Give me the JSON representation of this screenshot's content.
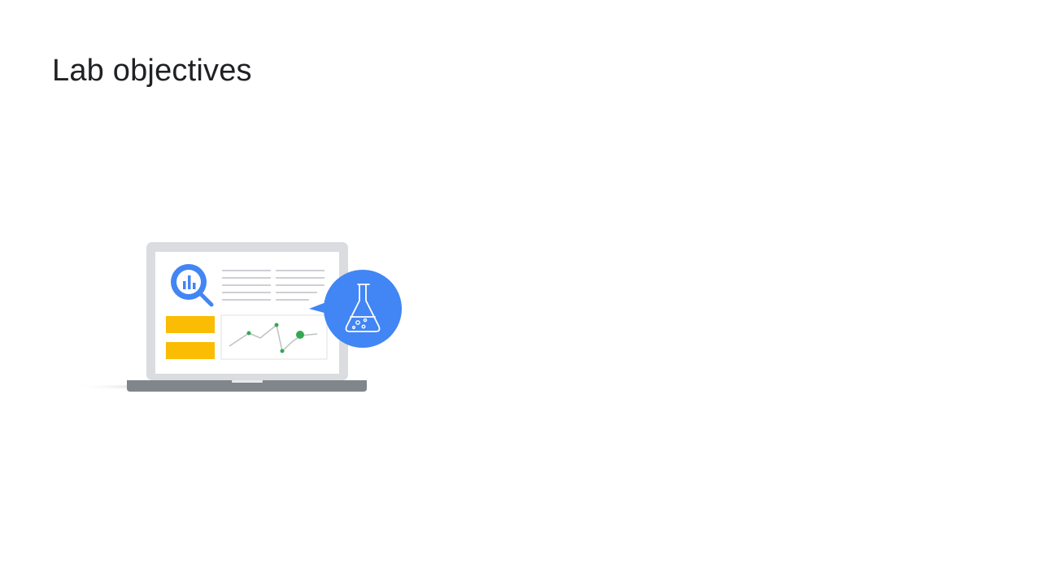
{
  "slide": {
    "title": "Lab objectives"
  },
  "illustration": {
    "icons": [
      "laptop-icon",
      "bigquery-magnifier-icon",
      "lab-flask-icon",
      "line-chart-icon"
    ],
    "colors": {
      "blue": "#4285f4",
      "yellow": "#fbbc04",
      "green": "#34a853",
      "laptop_frame": "#dadce0",
      "laptop_base": "#80868b",
      "lines": "#bdc1c6"
    }
  }
}
